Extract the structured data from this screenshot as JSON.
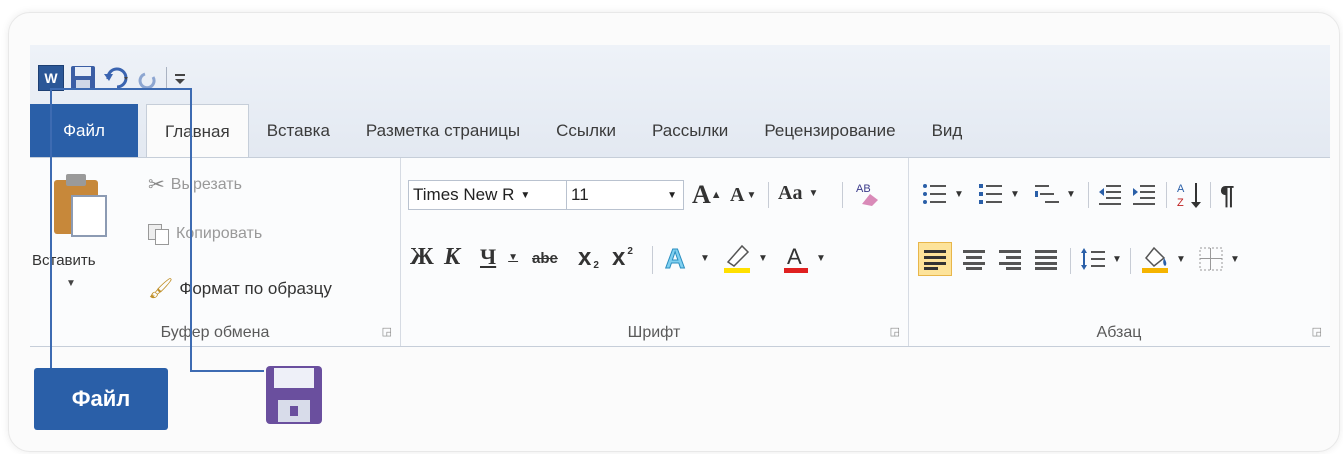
{
  "tabs": [
    {
      "label": "Файл"
    },
    {
      "label": "Главная"
    },
    {
      "label": "Вставка"
    },
    {
      "label": "Разметка страницы"
    },
    {
      "label": "Ссылки"
    },
    {
      "label": "Рассылки"
    },
    {
      "label": "Рецензирование"
    },
    {
      "label": "Вид"
    }
  ],
  "clipboard": {
    "paste_label": "Вставить",
    "cut_label": "Вырезать",
    "copy_label": "Копировать",
    "format_painter_label": "Формат по образцу",
    "group_label": "Буфер обмена"
  },
  "font": {
    "font_name": "Times New R",
    "font_size": "11",
    "grow_glyph": "A",
    "shrink_glyph": "A",
    "case_glyph": "Aa",
    "bold": "Ж",
    "italic": "К",
    "underline": "Ч",
    "strike": "abe",
    "subscript": "x",
    "superscript": "x",
    "group_label": "Шрифт"
  },
  "paragraph": {
    "group_label": "Абзац"
  },
  "callouts": {
    "file_button_label": "Файл"
  },
  "colors": {
    "accent": "#2a5fa8",
    "font_color_bar": "#e02020",
    "highlight_bar": "#ffe000"
  }
}
